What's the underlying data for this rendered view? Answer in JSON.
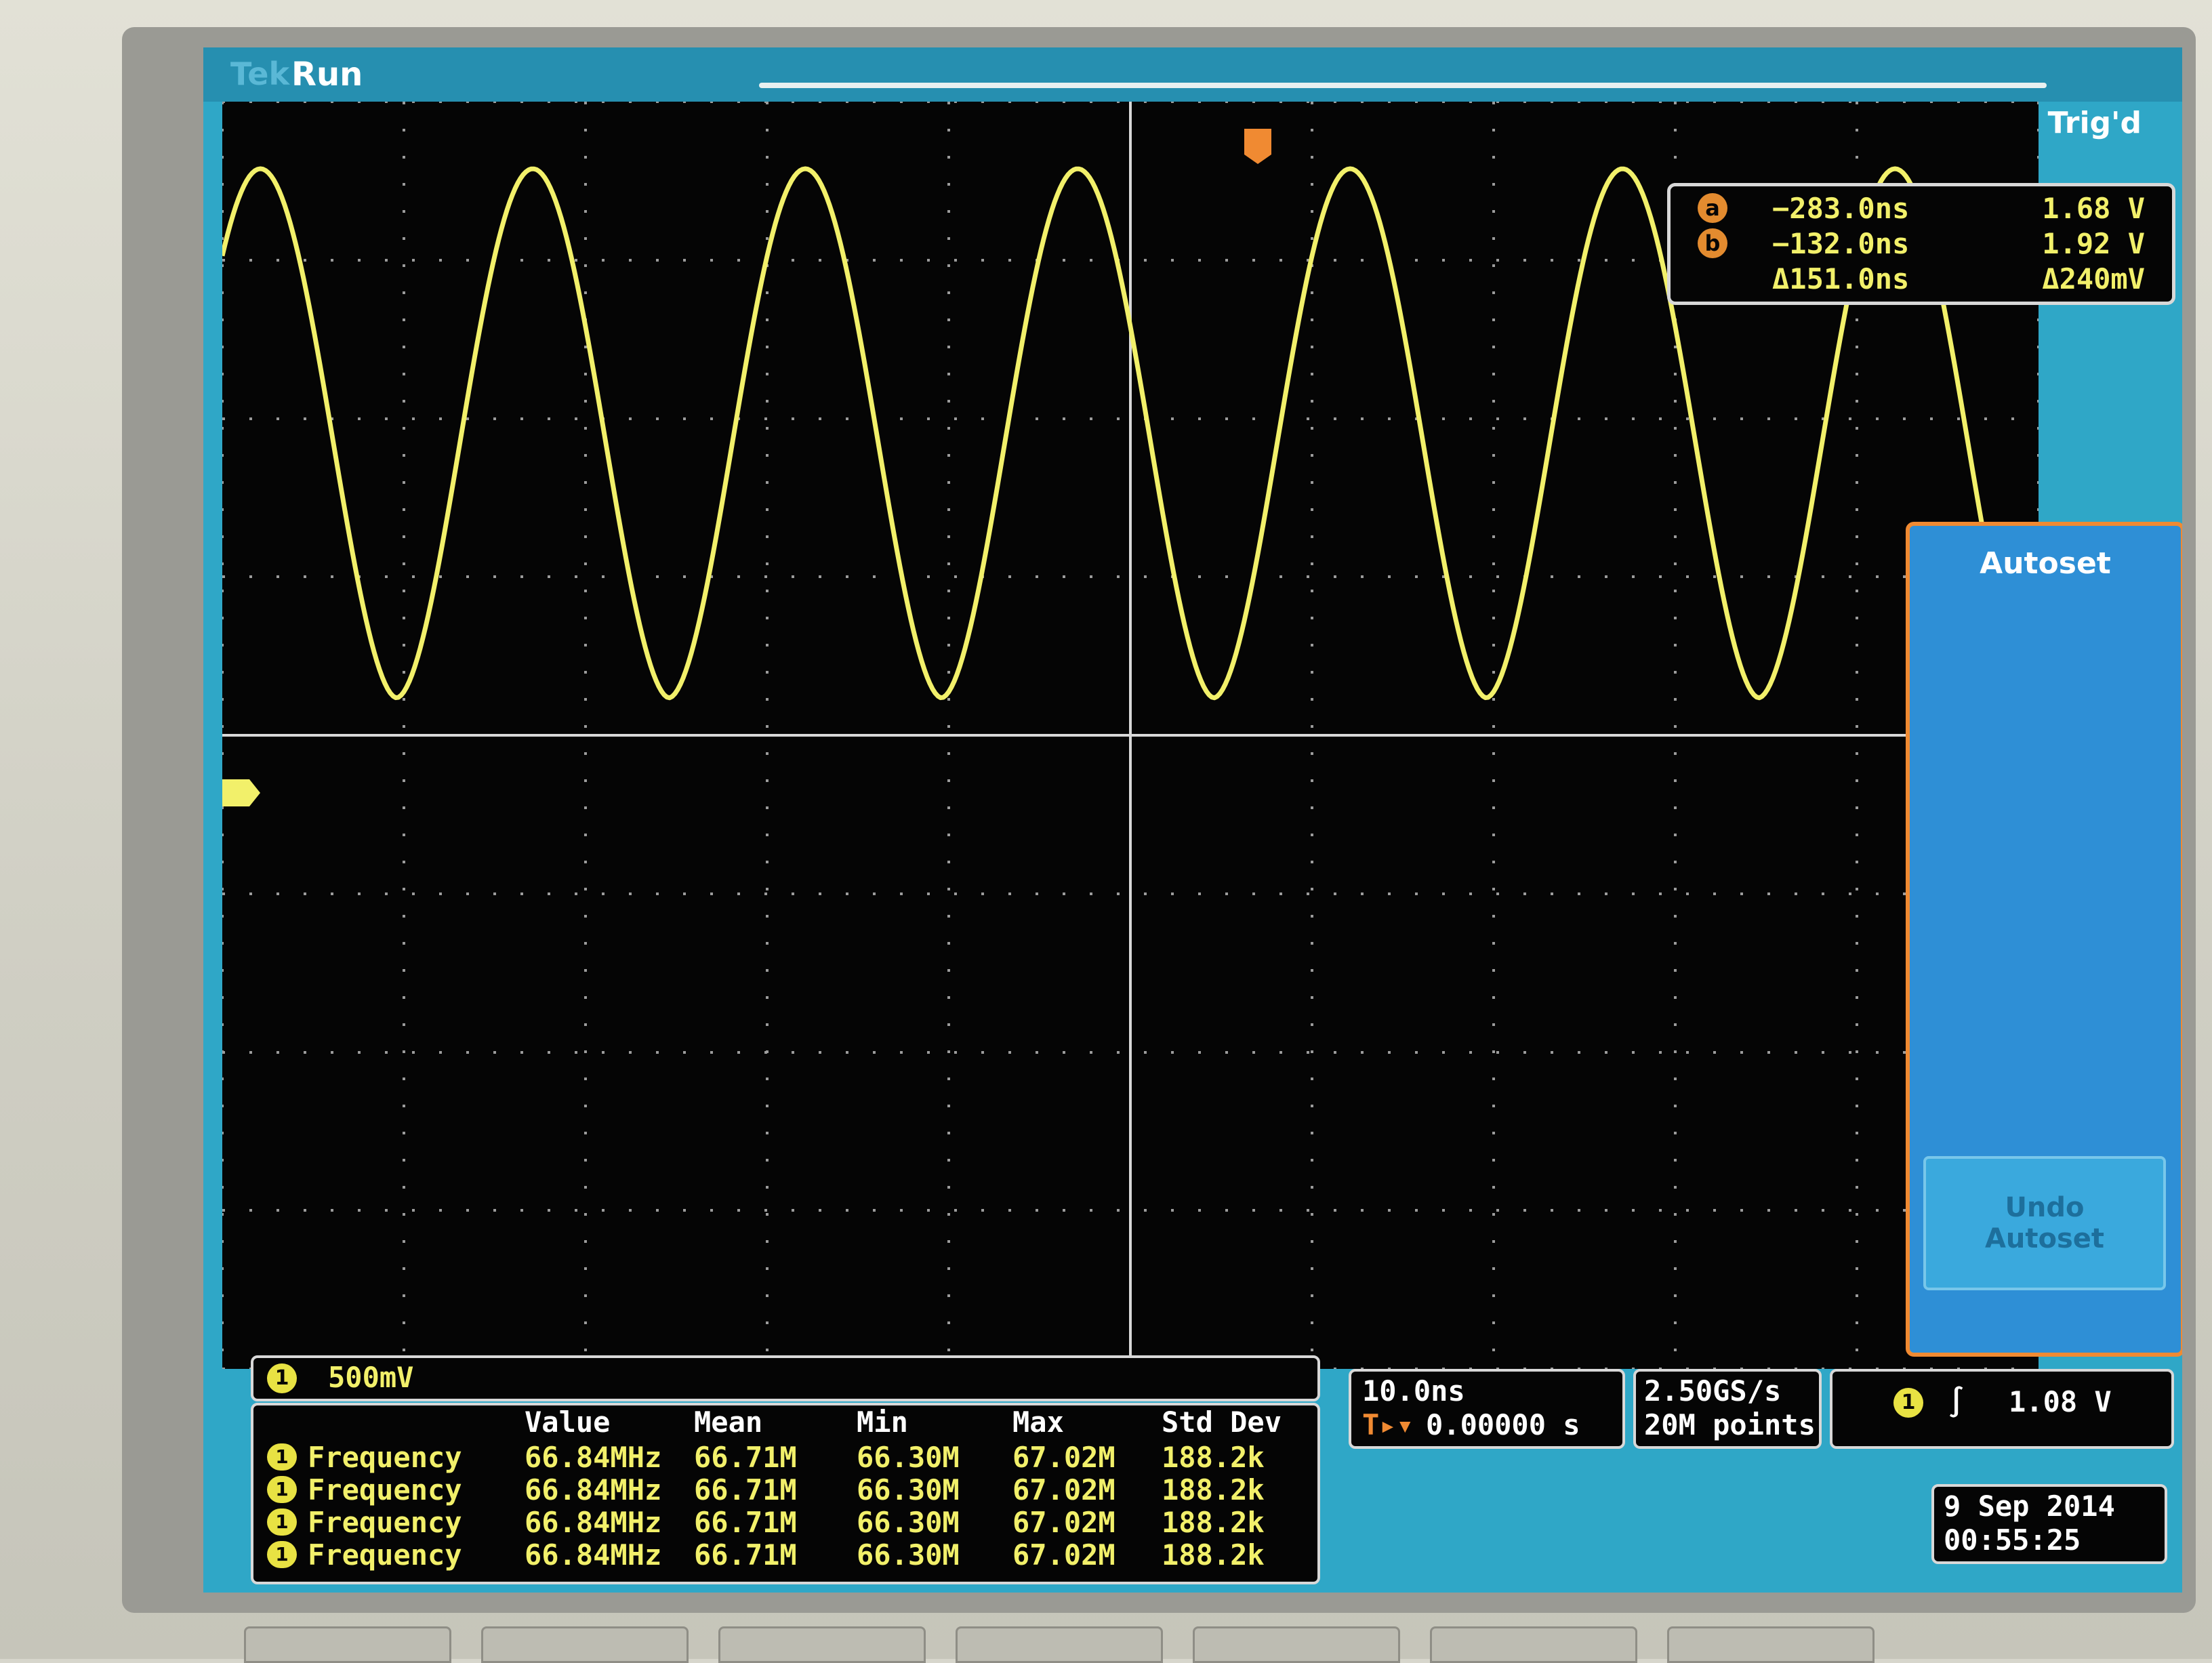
{
  "brand": "Tek",
  "status": {
    "run": "Run",
    "trigger": "Trig'd"
  },
  "cursors": {
    "a": {
      "label": "a",
      "time": "−283.0ns",
      "voltage": "1.68 V"
    },
    "b": {
      "label": "b",
      "time": "−132.0ns",
      "voltage": "1.92 V"
    },
    "delta": {
      "time": "Δ151.0ns",
      "voltage": "Δ240mV"
    }
  },
  "side_menu": {
    "autoset": "Autoset",
    "undo_line1": "Undo",
    "undo_line2": "Autoset"
  },
  "channel": {
    "number": "1",
    "scale": "500mV"
  },
  "measurements": {
    "headers": [
      "Value",
      "Mean",
      "Min",
      "Max",
      "Std Dev"
    ],
    "rows": [
      {
        "ch": "1",
        "name": "Frequency",
        "value": "66.84MHz",
        "mean": "66.71M",
        "min": "66.30M",
        "max": "67.02M",
        "std": "188.2k"
      },
      {
        "ch": "1",
        "name": "Frequency",
        "value": "66.84MHz",
        "mean": "66.71M",
        "min": "66.30M",
        "max": "67.02M",
        "std": "188.2k"
      },
      {
        "ch": "1",
        "name": "Frequency",
        "value": "66.84MHz",
        "mean": "66.71M",
        "min": "66.30M",
        "max": "67.02M",
        "std": "188.2k"
      },
      {
        "ch": "1",
        "name": "Frequency",
        "value": "66.84MHz",
        "mean": "66.71M",
        "min": "66.30M",
        "max": "67.02M",
        "std": "188.2k"
      }
    ]
  },
  "horizontal": {
    "scale": "10.0ns",
    "position": "0.00000 s"
  },
  "acquisition": {
    "rate": "2.50GS/s",
    "points": "20M points"
  },
  "trigger": {
    "channel": "1",
    "level": "1.08 V"
  },
  "datetime": {
    "date": "9 Sep  2014",
    "time": "00:55:25"
  },
  "colors": {
    "trace": "#f2f06a",
    "screen_bg": "#2fa7c7",
    "graticule": "#050505",
    "menu_border": "#f08a32"
  },
  "waveform": {
    "period_ns": 15.0,
    "min_v": 0.3,
    "max_v": 1.97
  }
}
